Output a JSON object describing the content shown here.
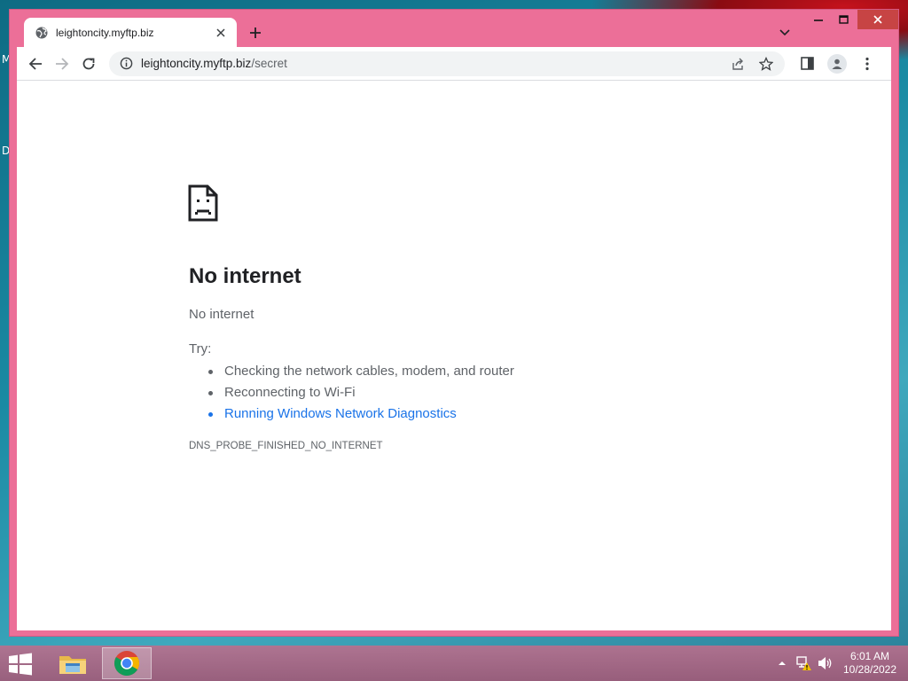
{
  "desktop": {
    "edge_letters": [
      "M",
      "D"
    ]
  },
  "browser": {
    "tab": {
      "title": "leightoncity.myftp.biz"
    },
    "omnibox": {
      "host": "leightoncity.myftp.biz",
      "path": "/secret"
    }
  },
  "page": {
    "heading": "No internet",
    "subtitle": "No internet",
    "try_label": "Try:",
    "suggestions": [
      "Checking the network cables, modem, and router",
      "Reconnecting to Wi-Fi",
      "Running Windows Network Diagnostics"
    ],
    "error_code": "DNS_PROBE_FINISHED_NO_INTERNET"
  },
  "taskbar": {
    "time": "6:01 AM",
    "date": "10/28/2022"
  },
  "colors": {
    "window_frame": "#ec6f98",
    "link": "#1a73e8",
    "text_secondary": "#5f6368"
  },
  "icons": [
    "globe-icon",
    "close-icon",
    "plus-icon",
    "chevron-down-icon",
    "minimize-icon",
    "maximize-icon",
    "back-icon",
    "forward-icon",
    "reload-icon",
    "info-icon",
    "share-icon",
    "star-icon",
    "side-panel-icon",
    "profile-icon",
    "menu-icon",
    "sad-page-icon",
    "windows-start-icon",
    "file-explorer-icon",
    "chrome-icon",
    "tray-arrow-icon",
    "network-warning-icon",
    "volume-icon"
  ]
}
